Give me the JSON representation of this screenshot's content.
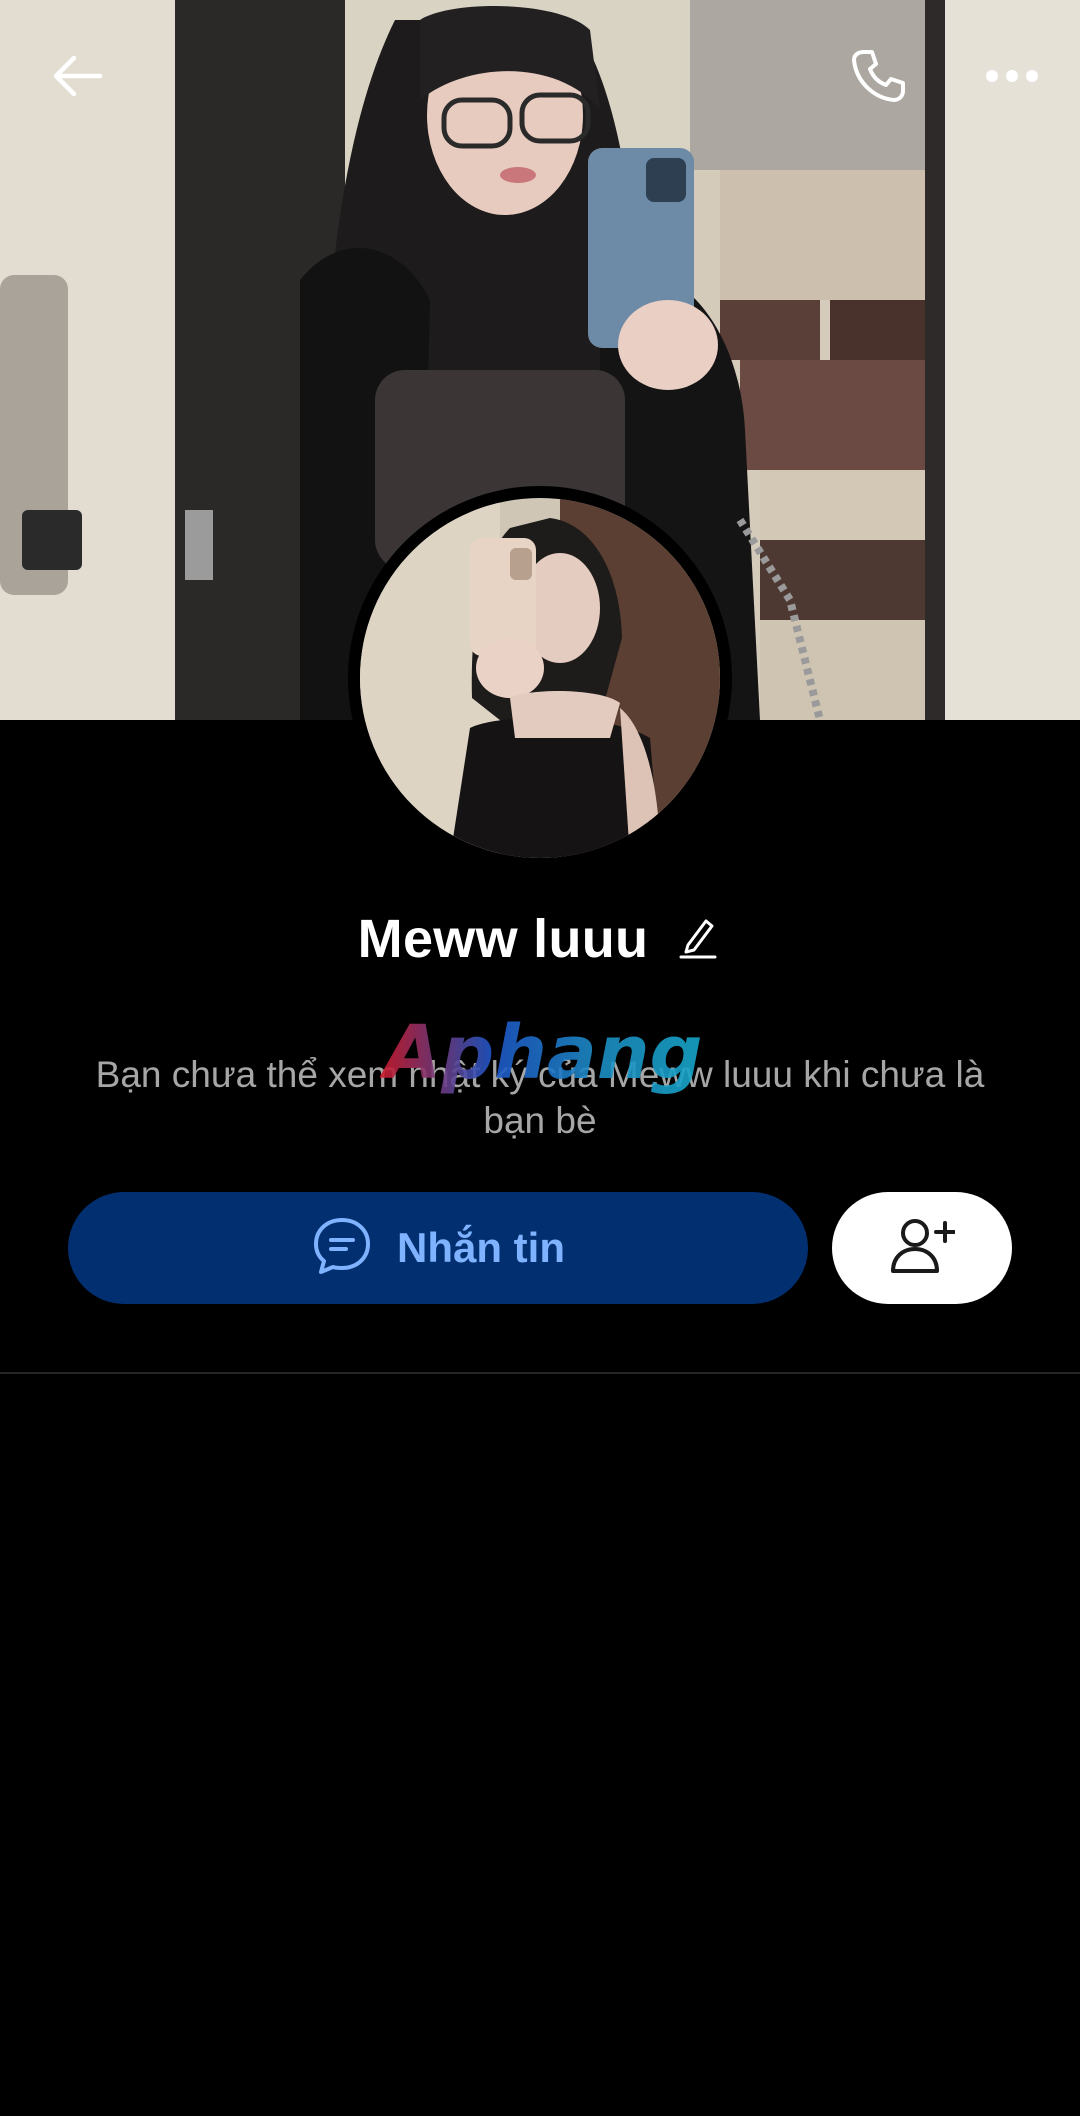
{
  "profile": {
    "name": "Meww luuu"
  },
  "notice": {
    "text": "Bạn chưa thể xem nhật ký của Meww luuu khi chưa là bạn bè"
  },
  "actions": {
    "message_label": "Nhắn tin"
  },
  "watermark": {
    "text": "Aphang"
  },
  "icons": {
    "back": "back-arrow-icon",
    "call": "phone-icon",
    "more": "more-dots-icon",
    "edit": "pencil-icon",
    "chat": "chat-bubble-icon",
    "add_friend": "add-user-icon"
  },
  "colors": {
    "background": "#000000",
    "message_button_bg": "#022f6f",
    "message_button_text": "#7fb2ff",
    "notice_text": "#a6a6a6"
  }
}
